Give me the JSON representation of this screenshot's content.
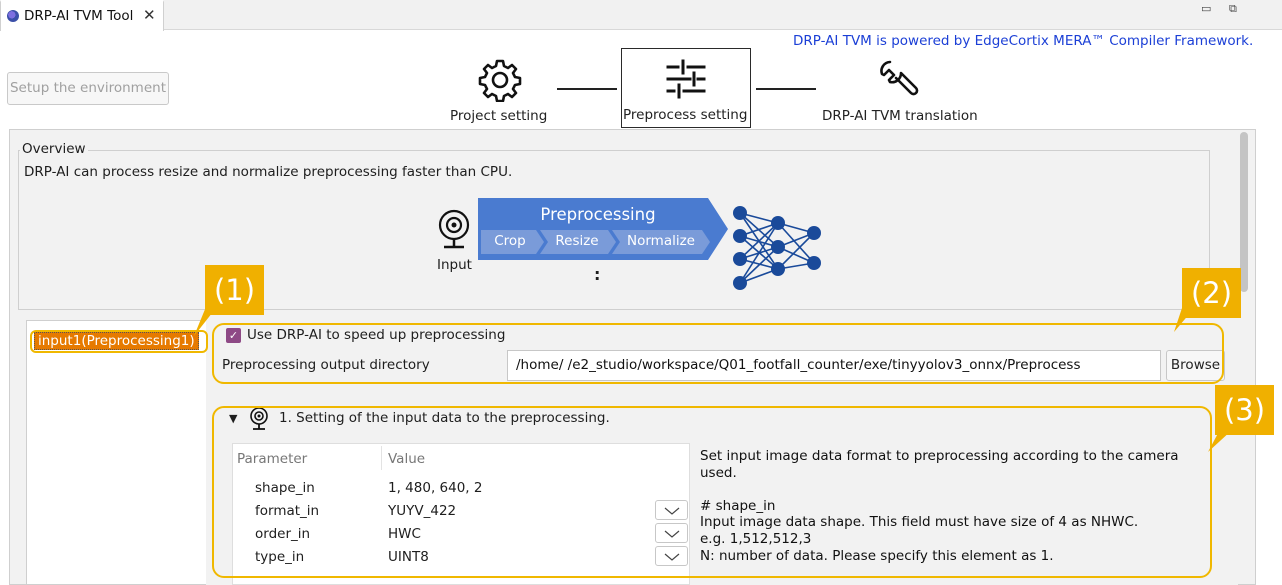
{
  "tab": {
    "title": "DRP-AI TVM Tool",
    "close": "✕",
    "icon": "eclipse-icon"
  },
  "window_controls": {
    "minimize": "▭",
    "maximize": "⧉"
  },
  "header": {
    "powered_by": "DRP-AI TVM is powered by EdgeCortix MERA™ Compiler Framework.",
    "setup_button": "Setup the environment"
  },
  "steps": [
    {
      "label": "Project setting",
      "icon": "gear-icon"
    },
    {
      "label": "Preprocess setting",
      "icon": "sliders-icon",
      "active": true
    },
    {
      "label": "DRP-AI TVM translation",
      "icon": "wrench-icon"
    }
  ],
  "overview": {
    "title": "Overview",
    "text": "DRP-AI can process resize and normalize preprocessing faster than CPU.",
    "diagram": {
      "input_label": "Input",
      "pre_title": "Preprocessing",
      "stages": [
        "Crop",
        "Resize",
        "Normalize"
      ],
      "colon": ":",
      "pre_color": "#4a7bd0",
      "stage_color": "#7a9bd9",
      "node_color": "#1a4a9a"
    }
  },
  "inputs_list": [
    "input1(Preprocessing1)"
  ],
  "settings": {
    "use_drpai_label": "Use DRP-AI to speed up preprocessing",
    "use_drpai_checked": true,
    "output_dir_label": "Preprocessing output directory",
    "output_dir_value": "/home/                 /e2_studio/workspace/Q01_footfall_counter/exe/tinyyolov3_onnx/Preprocess",
    "browse_label": "Browse"
  },
  "section1": {
    "title": "1. Setting of the input data to the preprocessing.",
    "table_headers": [
      "Parameter",
      "Value"
    ],
    "rows": [
      {
        "name": "shape_in",
        "value": "1, 480, 640, 2",
        "dropdown": false
      },
      {
        "name": "format_in",
        "value": "YUYV_422",
        "dropdown": true
      },
      {
        "name": "order_in",
        "value": "HWC",
        "dropdown": true
      },
      {
        "name": "type_in",
        "value": "UINT8",
        "dropdown": true
      }
    ],
    "description": "Set input image data format to preprocessing according to the camera\nused.\n\n# shape_in\nInput image data shape. This field must have size of 4 as NHWC.\ne.g. 1,512,512,3\nN: number of data. Please specify this element as 1."
  },
  "callouts": [
    "(1)",
    "(2)",
    "(3)"
  ],
  "colors": {
    "accent_callout": "#f0b800",
    "selection": "#e67a00",
    "link_blue": "#1b3fd6",
    "checkbox": "#8e4a86"
  }
}
